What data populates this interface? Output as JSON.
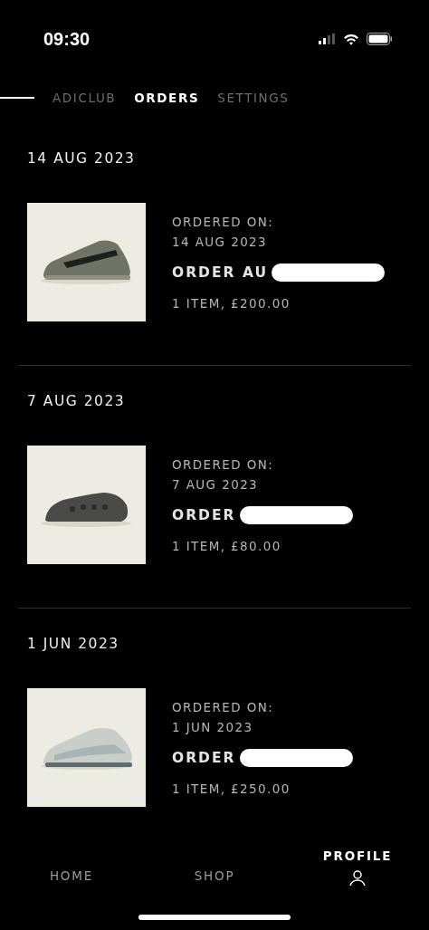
{
  "status_bar": {
    "time": "09:30"
  },
  "tabs": [
    {
      "label": "ADICLUB",
      "selected": false
    },
    {
      "label": "ORDERS",
      "selected": true
    },
    {
      "label": "SETTINGS",
      "selected": false
    }
  ],
  "orders": [
    {
      "date": "14 AUG 2023",
      "ordered_on_label": "ORDERED ON:",
      "ordered_on": "14 AUG 2023",
      "order_number": "ORDER AU",
      "summary": "1 ITEM, £200.00"
    },
    {
      "date": "7 AUG 2023",
      "ordered_on_label": "ORDERED ON:",
      "ordered_on": "7 AUG 2023",
      "order_number": "ORDER",
      "summary": "1 ITEM, £80.00"
    },
    {
      "date": "1 JUN 2023",
      "ordered_on_label": "ORDERED ON:",
      "ordered_on": "1 JUN 2023",
      "order_number": "ORDER",
      "summary": "1 ITEM, £250.00"
    }
  ],
  "bottom_nav": [
    {
      "label": "HOME",
      "selected": false
    },
    {
      "label": "SHOP",
      "selected": false
    },
    {
      "label": "PROFILE",
      "selected": true
    }
  ]
}
